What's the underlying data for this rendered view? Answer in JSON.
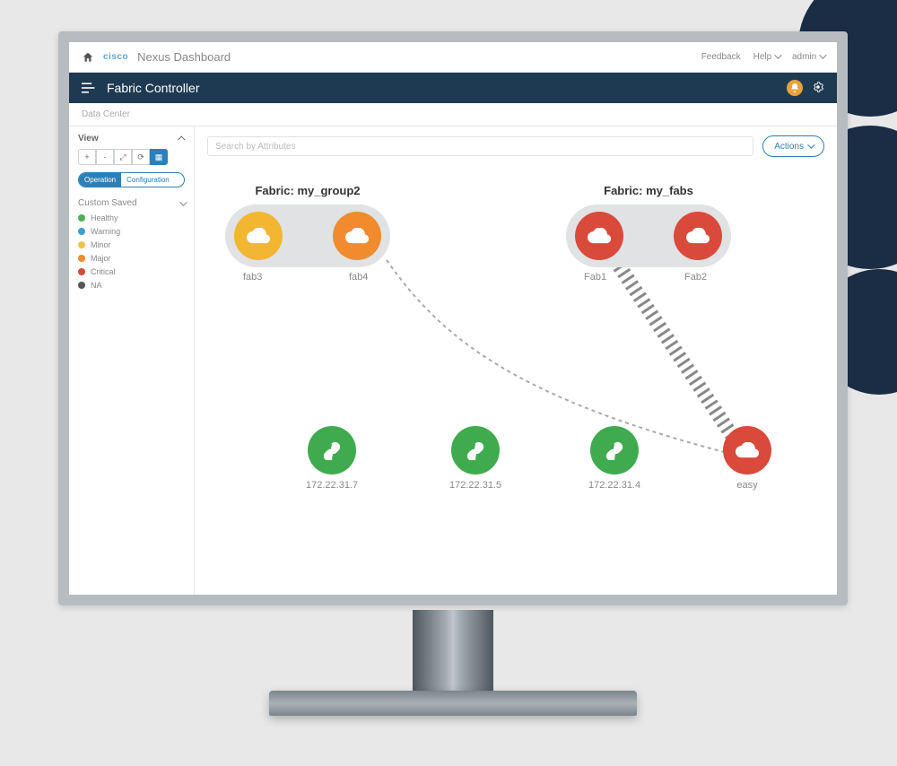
{
  "topbar": {
    "brand": "cisco",
    "title": "Nexus Dashboard",
    "feedback": "Feedback",
    "help": "Help",
    "user": "admin"
  },
  "subheader": {
    "title": "Fabric Controller"
  },
  "breadcrumb": "Data Center",
  "sidebar": {
    "view_label": "View",
    "toolbar": [
      "+",
      "-",
      "⤢",
      "⟳",
      "▦"
    ],
    "toggle": {
      "operation": "Operation",
      "configuration": "Configuration"
    },
    "legend_title": "Custom Saved",
    "legend": [
      {
        "label": "Healthy",
        "color": "#4caf50"
      },
      {
        "label": "Warning",
        "color": "#3e9bd6"
      },
      {
        "label": "Minor",
        "color": "#f2c24b"
      },
      {
        "label": "Major",
        "color": "#f08c2e"
      },
      {
        "label": "Critical",
        "color": "#d94a3a"
      },
      {
        "label": "NA",
        "color": "#555"
      }
    ]
  },
  "content": {
    "search_placeholder": "Search by Attributes",
    "actions_label": "Actions"
  },
  "topology": {
    "groups": [
      {
        "name": "Fabric: my_group2",
        "nodes": [
          "fab3",
          "fab4"
        ]
      },
      {
        "name": "Fabric: my_fabs",
        "nodes": [
          "Fab1",
          "Fab2"
        ]
      }
    ],
    "fab3": {
      "label": "fab3",
      "color": "#f2b631"
    },
    "fab4": {
      "label": "fab4",
      "color": "#f08c2e"
    },
    "fab1": {
      "label": "Fab1",
      "color": "#d94a3a"
    },
    "fab2": {
      "label": "Fab2",
      "color": "#d94a3a"
    },
    "ip1": {
      "label": "172.22.31.7",
      "color": "#3fab4e"
    },
    "ip2": {
      "label": "172.22.31.5",
      "color": "#3fab4e"
    },
    "ip3": {
      "label": "172.22.31.4",
      "color": "#3fab4e"
    },
    "easy": {
      "label": "easy",
      "color": "#d94a3a"
    }
  },
  "colors": {
    "header_dark": "#1e3a52",
    "accent": "#2c7fb8"
  }
}
